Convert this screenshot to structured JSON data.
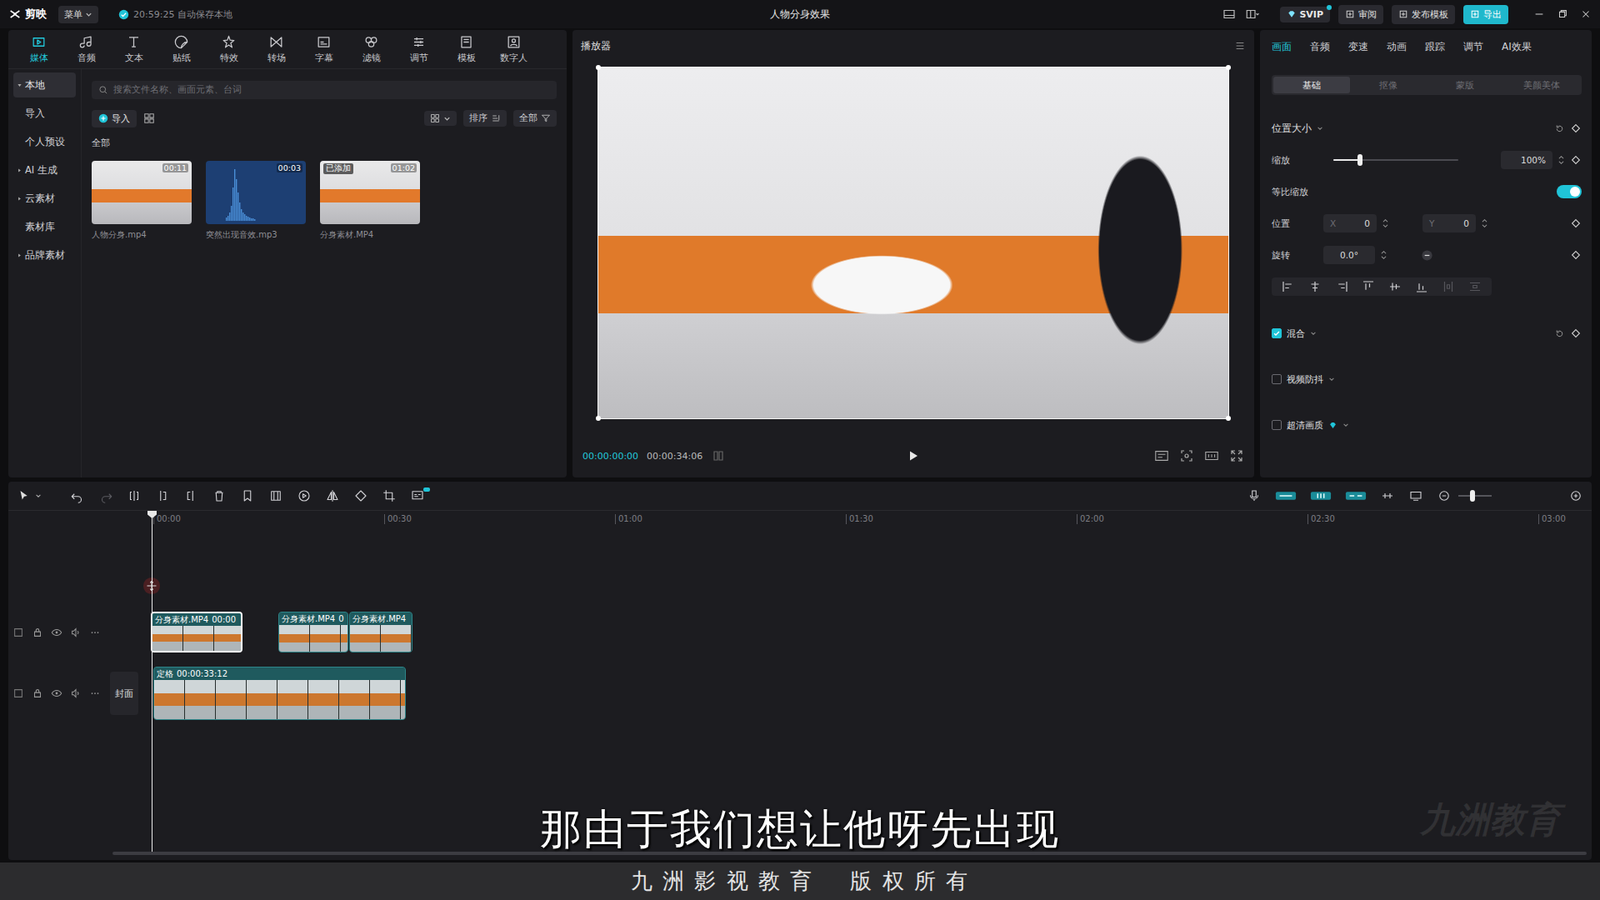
{
  "topbar": {
    "logo": "剪映",
    "menu": "菜单",
    "save_status": "20:59:25 自动保存本地",
    "title": "人物分身效果",
    "vip": "SVIP",
    "actions": [
      {
        "label": "审阅",
        "primary": false
      },
      {
        "label": "发布模板",
        "primary": false
      },
      {
        "label": "导出",
        "primary": true
      }
    ]
  },
  "tool_tabs": [
    {
      "label": "媒体",
      "selected": true
    },
    {
      "label": "音频",
      "selected": false
    },
    {
      "label": "文本",
      "selected": false
    },
    {
      "label": "贴纸",
      "selected": false
    },
    {
      "label": "特效",
      "selected": false
    },
    {
      "label": "转场",
      "selected": false
    },
    {
      "label": "字幕",
      "selected": false
    },
    {
      "label": "滤镜",
      "selected": false
    },
    {
      "label": "调节",
      "selected": false
    },
    {
      "label": "模板",
      "selected": false
    },
    {
      "label": "数字人",
      "selected": false
    }
  ],
  "media_sidebar": [
    {
      "label": "本地",
      "group": true,
      "expanded": true,
      "selected": true
    },
    {
      "label": "导入",
      "group": false,
      "expanded": false,
      "selected": false
    },
    {
      "label": "个人预设",
      "group": false,
      "expanded": false,
      "selected": false
    },
    {
      "label": "AI 生成",
      "group": true,
      "expanded": false,
      "selected": false
    },
    {
      "label": "云素材",
      "group": true,
      "expanded": false,
      "selected": false
    },
    {
      "label": "素材库",
      "group": false,
      "expanded": false,
      "selected": false
    },
    {
      "label": "品牌素材",
      "group": true,
      "expanded": false,
      "selected": false
    }
  ],
  "media": {
    "search_placeholder": "搜索文件名称、画面元素、台词",
    "import": "导入",
    "sort": "排序",
    "filter": "全部",
    "section": "全部",
    "added_badge": "已添加",
    "items": [
      {
        "name": "人物分身.mp4",
        "duration": "00:11",
        "kind": "video",
        "added": false
      },
      {
        "name": "突然出现音效.mp3",
        "duration": "00:03",
        "kind": "audio",
        "added": false
      },
      {
        "name": "分身素材.MP4",
        "duration": "01:02",
        "kind": "video",
        "added": true
      }
    ]
  },
  "player": {
    "title": "播放器",
    "current_time": "00:00:00:00",
    "duration": "00:00:34:06"
  },
  "inspector": {
    "tabs": [
      {
        "label": "画面",
        "selected": true
      },
      {
        "label": "音频",
        "selected": false
      },
      {
        "label": "变速",
        "selected": false
      },
      {
        "label": "动画",
        "selected": false
      },
      {
        "label": "跟踪",
        "selected": false
      },
      {
        "label": "调节",
        "selected": false
      },
      {
        "label": "AI效果",
        "selected": false
      }
    ],
    "subtabs": [
      {
        "label": "基础",
        "selected": true
      },
      {
        "label": "抠像",
        "selected": false
      },
      {
        "label": "蒙版",
        "selected": false
      },
      {
        "label": "美颜美体",
        "selected": false
      }
    ],
    "section": "位置大小",
    "scale": {
      "label": "缩放",
      "level": 0.21,
      "value": "100%"
    },
    "uniform_scale": {
      "label": "等比缩放",
      "on": true
    },
    "position": {
      "label": "位置",
      "x_label": "X",
      "x": "0",
      "y_label": "Y",
      "y": "0"
    },
    "rotation": {
      "label": "旋转",
      "value": "0.0°"
    },
    "options": [
      {
        "label": "混合",
        "checked": true,
        "vip": false
      },
      {
        "label": "视频防抖",
        "checked": false,
        "vip": false
      },
      {
        "label": "超清画质",
        "checked": false,
        "vip": true
      }
    ]
  },
  "timeline": {
    "ruler": [
      "00:00",
      "00:30",
      "01:00",
      "01:30",
      "02:00",
      "02:30",
      "03:00"
    ],
    "tracks": [
      {
        "cover": "",
        "clips": [
          {
            "label": "分身素材.MP4",
            "time": "00:00",
            "selected": true
          },
          {
            "label": "分身素材.MP4",
            "time": "0",
            "selected": false
          },
          {
            "label": "分身素材.MP4",
            "time": "",
            "selected": false
          }
        ]
      },
      {
        "cover": "封面",
        "clips": [
          {
            "label": "定格",
            "time": "00:00:33:12",
            "selected": false
          }
        ]
      }
    ]
  },
  "caption": "那由于我们想让他呀先出现",
  "watermark": "九洲教育",
  "footer": [
    "九 洲 影 视 教 育",
    "版 权 所 有"
  ]
}
